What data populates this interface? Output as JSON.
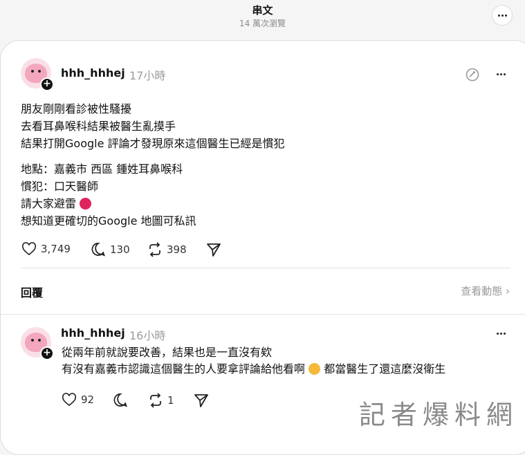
{
  "header": {
    "title": "串文",
    "views": "14 萬次瀏覽"
  },
  "post": {
    "username": "hhh_hhhej",
    "time": "17小時",
    "paragraph1": [
      "朋友剛剛看診被性騷擾",
      "去看耳鼻喉科結果被醫生亂摸手",
      "結果打開Google 評論才發現原來這個醫生已經是慣犯"
    ],
    "paragraph2": [
      "地點：嘉義市 西區 鍾姓耳鼻喉科",
      "慣犯：口天醫師",
      "請大家避雷",
      "想知道更確切的Google 地圖可私訊"
    ],
    "likes": "3,749",
    "comments": "130",
    "reposts": "398"
  },
  "reply_section": {
    "label": "回覆",
    "view_activity": "查看動態"
  },
  "reply": {
    "username": "hhh_hhhej",
    "time": "16小時",
    "line1": "從兩年前就說要改善，結果也是一直沒有欸",
    "line2a": "有沒有嘉義市認識這個醫生的人要拿評論給他看啊",
    "line2b": " 都當醫生了還這麼沒衛生",
    "likes": "92",
    "reposts": "1"
  },
  "watermark": "記者爆料網",
  "colors": {
    "accent_text": "#111111",
    "muted": "#9a9a9a",
    "avatar_pink": "#f3a7bd"
  }
}
